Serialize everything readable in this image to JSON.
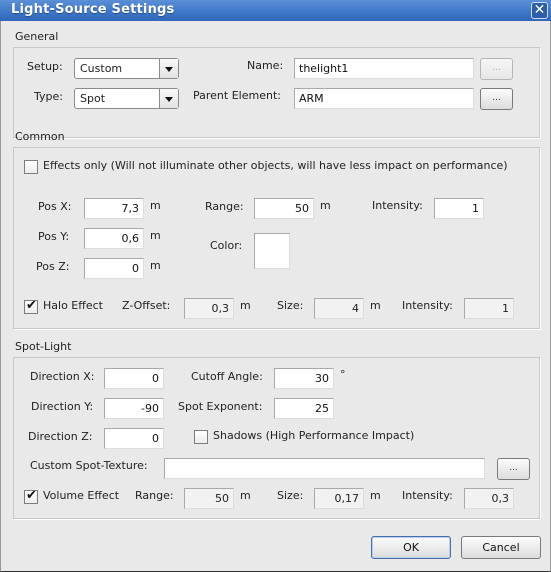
{
  "window": {
    "title": "Light-Source Settings",
    "close_icon": "close-icon"
  },
  "general": {
    "title": "General",
    "setup_label": "Setup:",
    "setup_value": "Custom",
    "type_label": "Type:",
    "type_value": "Spot",
    "name_label": "Name:",
    "name_value": "thelight1",
    "name_browse": "...",
    "parent_label": "Parent Element:",
    "parent_value": "ARM",
    "parent_browse": "..."
  },
  "common": {
    "title": "Common",
    "effects_only_label": "Effects only (Will not illuminate other objects, will have less impact on performance)",
    "effects_only_checked": false,
    "pos_x_label": "Pos X:",
    "pos_x": "7,3",
    "pos_y_label": "Pos Y:",
    "pos_y": "0,6",
    "pos_z_label": "Pos Z:",
    "pos_z": "0",
    "unit_m": "m",
    "range_label": "Range:",
    "range": "50",
    "intensity_label": "Intensity:",
    "intensity": "1",
    "color_label": "Color:",
    "color_value": "#ffffff",
    "halo_label": "Halo Effect",
    "halo_checked": true,
    "z_offset_label": "Z-Offset:",
    "z_offset": "0,3",
    "size_label": "Size:",
    "halo_size": "4",
    "halo_intensity_label": "Intensity:",
    "halo_intensity": "1"
  },
  "spot": {
    "title": "Spot-Light",
    "dir_x_label": "Direction X:",
    "dir_x": "0",
    "dir_y_label": "Direction Y:",
    "dir_y": "-90",
    "dir_z_label": "Direction Z:",
    "dir_z": "0",
    "cutoff_label": "Cutoff Angle:",
    "cutoff": "30",
    "degree_unit": "°",
    "exponent_label": "Spot Exponent:",
    "exponent": "25",
    "shadows_label": "Shadows (High Performance Impact)",
    "shadows_checked": false,
    "texture_label": "Custom Spot-Texture:",
    "texture_value": "",
    "texture_browse": "...",
    "volume_label": "Volume Effect",
    "volume_checked": true,
    "vol_range_label": "Range:",
    "vol_range": "50",
    "vol_size_label": "Size:",
    "vol_size": "0,17",
    "vol_intensity_label": "Intensity:",
    "vol_intensity": "0,3",
    "unit_m": "m"
  },
  "footer": {
    "ok": "OK",
    "cancel": "Cancel"
  }
}
